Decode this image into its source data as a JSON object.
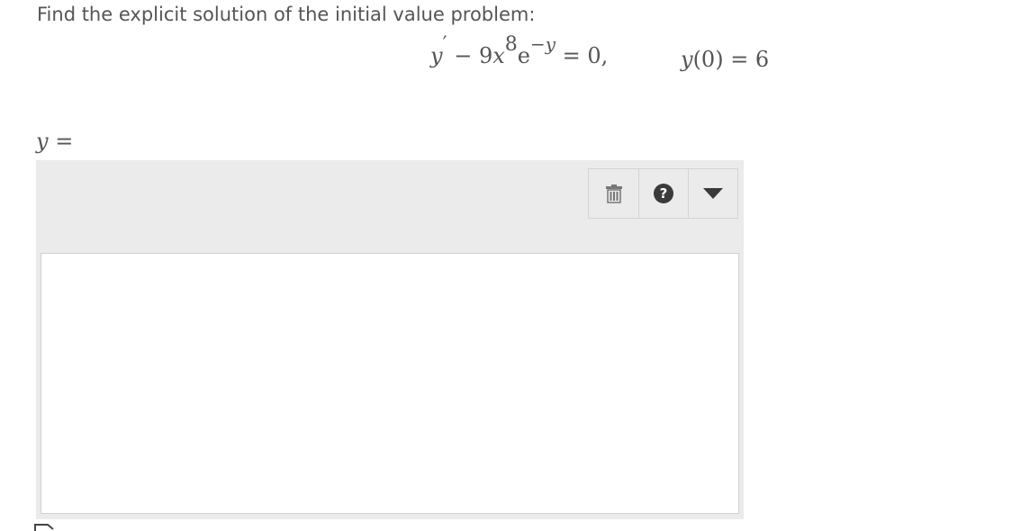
{
  "prompt": "Find the explicit solution of the initial value problem:",
  "equation": {
    "y": "y",
    "prime": "′",
    "minus": " − ",
    "coef": "9",
    "x": "x",
    "x_exp": "8",
    "e": "e",
    "e_exp_minus": "−",
    "e_exp_var": "y",
    "rhs": " = 0,"
  },
  "condition": {
    "var": "y",
    "arg": "(0)",
    "rhs": " = 6"
  },
  "answer": {
    "var": "y",
    "eq": " ="
  },
  "toolbar": {
    "delete_icon": "trash-icon",
    "help_icon": "help-icon",
    "help_glyph": "?",
    "menu_icon": "dropdown-arrow-icon"
  },
  "colors": {
    "text": "#555555",
    "editor_bg": "#ebebeb",
    "border": "#d4d4d4",
    "help_bg": "#3a3a3a"
  }
}
